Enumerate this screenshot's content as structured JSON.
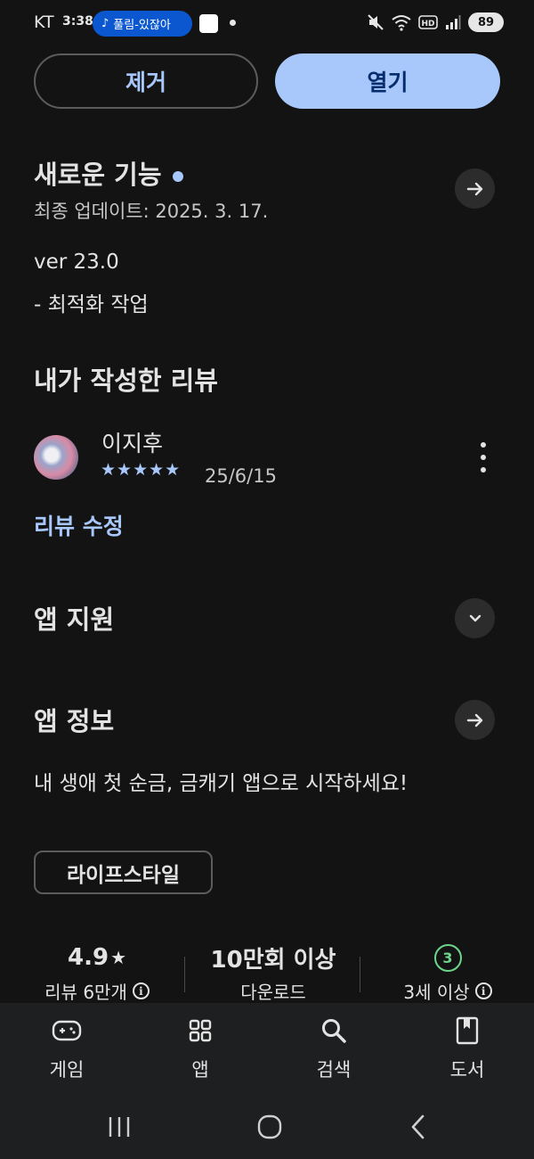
{
  "status_bar": {
    "carrier": "KT",
    "time": "3:38",
    "music_title": "풀림-있잖아",
    "battery": "89"
  },
  "actions": {
    "remove_label": "제거",
    "open_label": "열기"
  },
  "whats_new": {
    "title": "새로운 기능",
    "last_updated": "최종 업데이트: 2025. 3. 17.",
    "version": "ver 23.0",
    "notes": "- 최적화 작업"
  },
  "my_review": {
    "title": "내가 작성한 리뷰",
    "reviewer": "이지후",
    "rating": 5,
    "stars": "★★★★★",
    "date": "25/6/15",
    "edit_label": "리뷰 수정"
  },
  "app_support": {
    "title": "앱 지원"
  },
  "app_info": {
    "title": "앱 정보",
    "description": "내 생애 첫 순금, 금캐기 앱으로 시작하세요!",
    "category": "라이프스타일"
  },
  "stats": {
    "rating": "4.9",
    "rating_star": "★",
    "reviews_label": "리뷰 6만개",
    "downloads": "10만회 이상",
    "downloads_label": "다운로드",
    "age_badge": "3",
    "age_label": "3세 이상"
  },
  "bottom_nav": {
    "items": [
      {
        "label": "게임",
        "icon": "gamepad-icon"
      },
      {
        "label": "앱",
        "icon": "apps-grid-icon"
      },
      {
        "label": "검색",
        "icon": "search-icon"
      },
      {
        "label": "도서",
        "icon": "book-icon"
      }
    ]
  },
  "colors": {
    "background": "#131313",
    "accent": "#a8c7fa",
    "nav_bg": "#1e1f20",
    "age_green": "#6dd58c"
  }
}
